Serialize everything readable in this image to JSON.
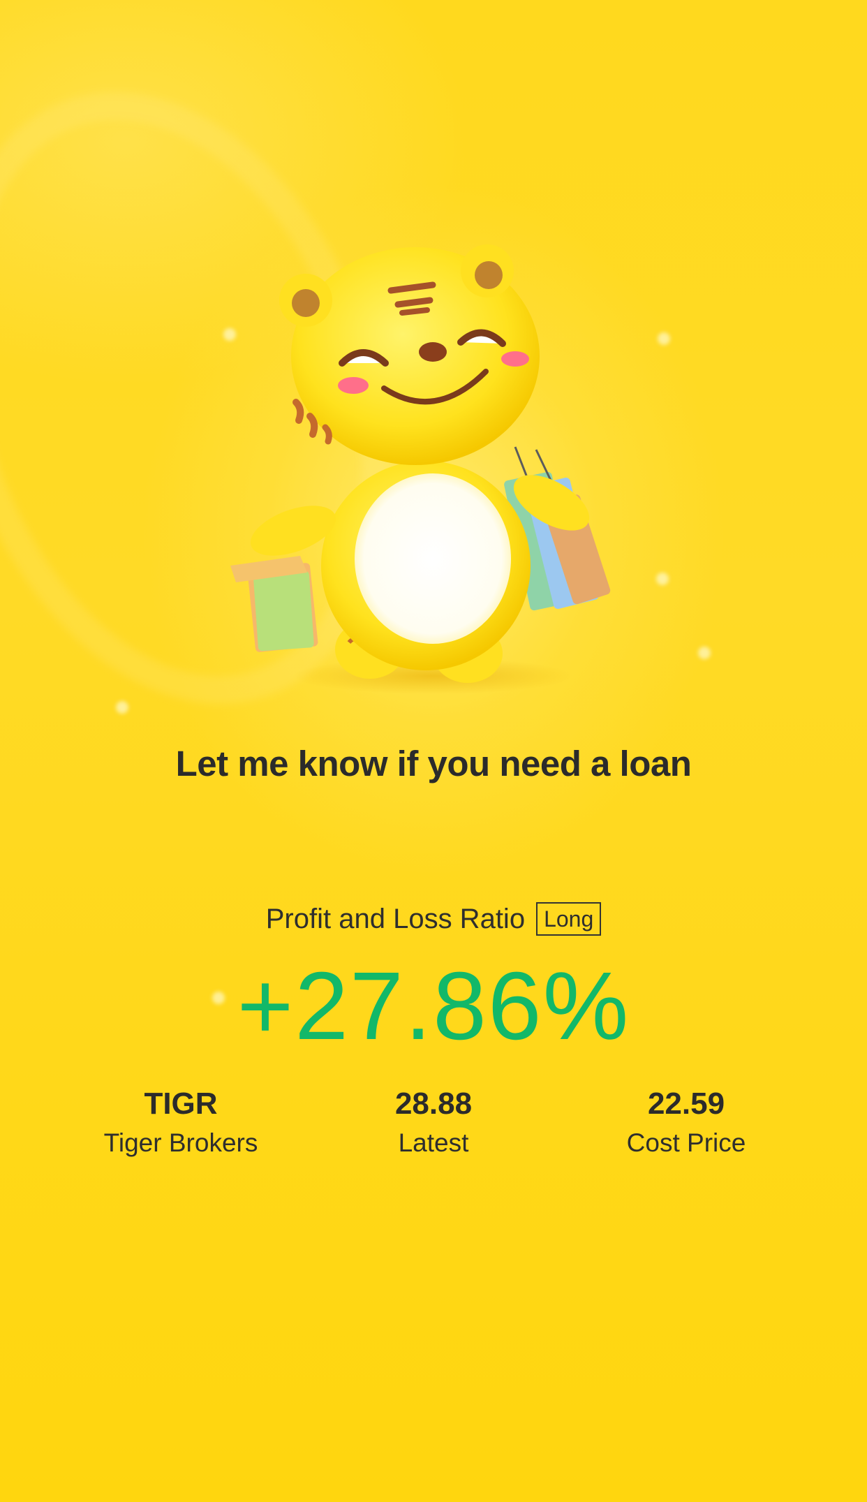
{
  "headline": "Let me know if you need a loan",
  "ratio": {
    "label": "Profit and Loss Ratio",
    "badge": "Long",
    "value": "+27.86%",
    "value_color": "#12B869"
  },
  "stats": [
    {
      "value": "TIGR",
      "label": "Tiger Brokers"
    },
    {
      "value": "28.88",
      "label": "Latest"
    },
    {
      "value": "22.59",
      "label": "Cost Price"
    }
  ],
  "colors": {
    "background": "#FFD81A",
    "text": "#2B2B2B"
  },
  "illustration": "tiger-mascot-with-shopping-bags"
}
